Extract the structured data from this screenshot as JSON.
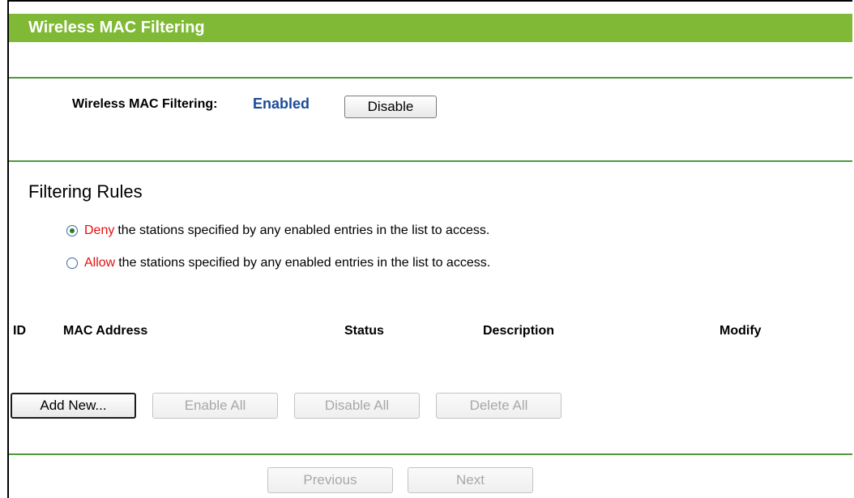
{
  "header": {
    "title": "Wireless MAC Filtering"
  },
  "status": {
    "label": "Wireless MAC Filtering:",
    "value": "Enabled",
    "toggle_label": "Disable"
  },
  "rules": {
    "title": "Filtering Rules",
    "deny": {
      "keyword": "Deny",
      "text": "the stations specified by any enabled entries in the list to access.",
      "checked": true
    },
    "allow": {
      "keyword": "Allow",
      "text": "the stations specified by any enabled entries in the list to access.",
      "checked": false
    }
  },
  "table": {
    "columns": [
      "ID",
      "MAC Address",
      "Status",
      "Description",
      "Modify"
    ],
    "rows": []
  },
  "actions": {
    "add_new": "Add New...",
    "enable_all": "Enable All",
    "disable_all": "Disable All",
    "delete_all": "Delete All"
  },
  "paging": {
    "previous": "Previous",
    "next": "Next"
  },
  "colors": {
    "header_bg": "#7fb935",
    "rule": "#4c9a38",
    "keyword": "#e20f0f",
    "status_value": "#1a4a9a"
  }
}
